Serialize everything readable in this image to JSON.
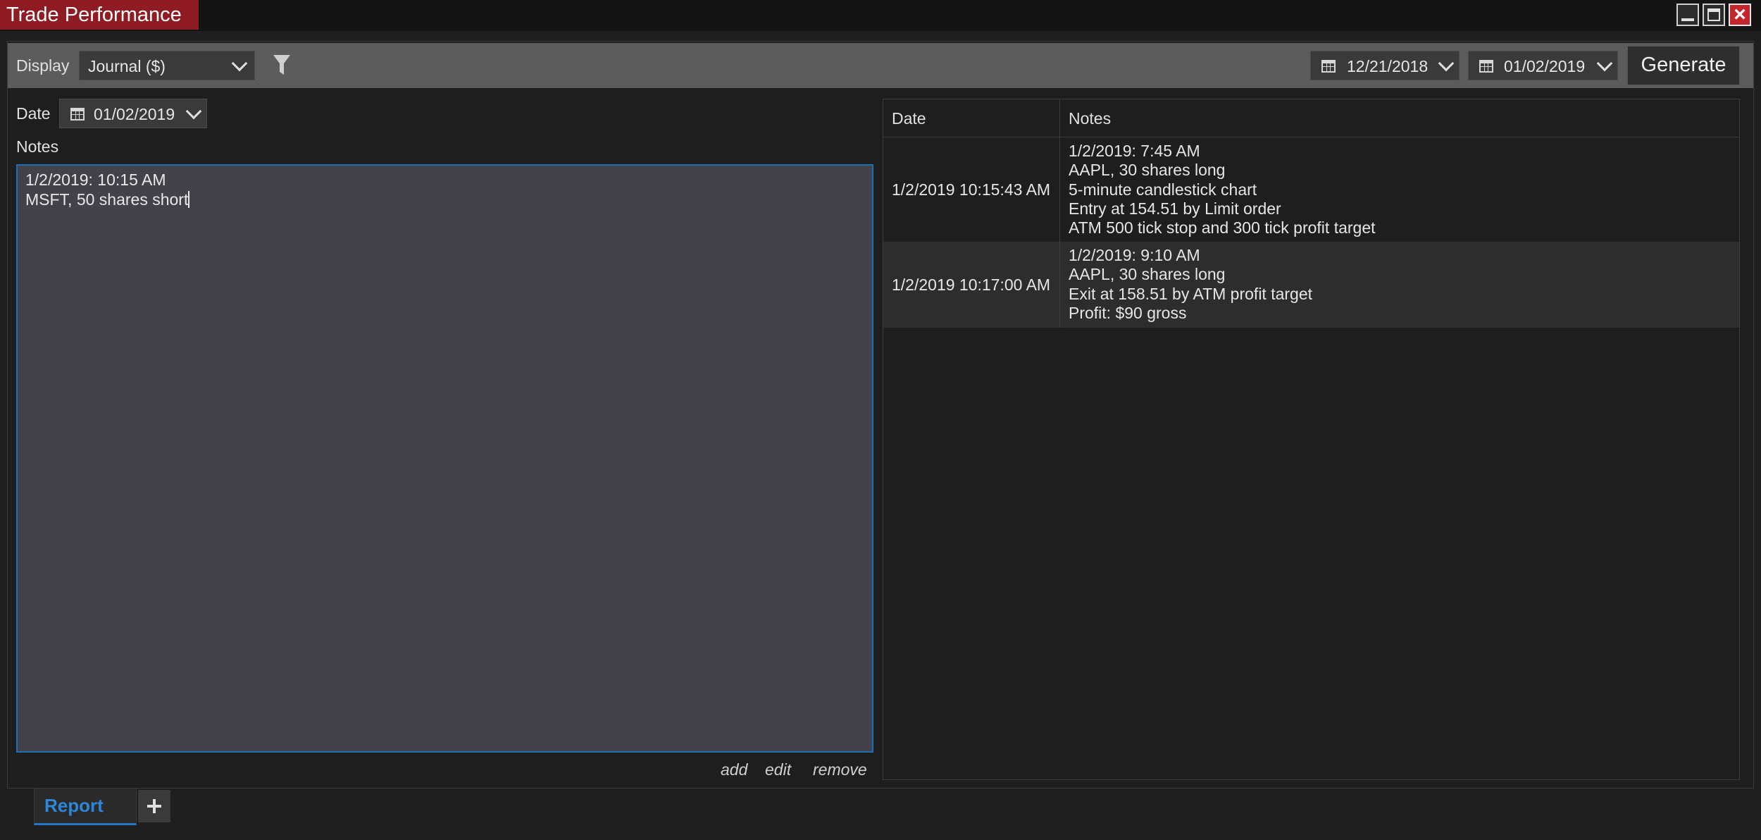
{
  "window": {
    "title": "Trade Performance"
  },
  "toolbar": {
    "display_label": "Display",
    "display_value": "Journal ($)",
    "start_date": "12/21/2018",
    "end_date": "01/02/2019",
    "generate_label": "Generate"
  },
  "journal": {
    "date_label": "Date",
    "date_value": "01/02/2019",
    "notes_label": "Notes",
    "notes_lines": [
      "1/2/2019: 10:15 AM",
      "MSFT, 50 shares short"
    ],
    "actions": {
      "add": "add",
      "edit": "edit",
      "remove": "remove"
    }
  },
  "table": {
    "headers": {
      "date": "Date",
      "notes": "Notes"
    },
    "rows": [
      {
        "date": "1/2/2019 10:15:43 AM",
        "notes": [
          "1/2/2019: 7:45 AM",
          "AAPL, 30 shares long",
          "5-minute candlestick chart",
          "Entry at 154.51 by Limit order",
          "ATM 500 tick stop and 300 tick profit target"
        ]
      },
      {
        "date": "1/2/2019 10:17:00 AM",
        "notes": [
          "1/2/2019: 9:10 AM",
          "AAPL, 30 shares long",
          "Exit at 158.51 by ATM profit target",
          "Profit: $90 gross"
        ]
      }
    ]
  },
  "tabs": {
    "report_label": "Report"
  },
  "colors": {
    "title_bg": "#8f1c22",
    "accent_blue": "#2477c4",
    "toolbar_bg": "#5c5c5c",
    "editor_bg": "#43424a",
    "selected_row_bg": "#2d2d2d"
  }
}
